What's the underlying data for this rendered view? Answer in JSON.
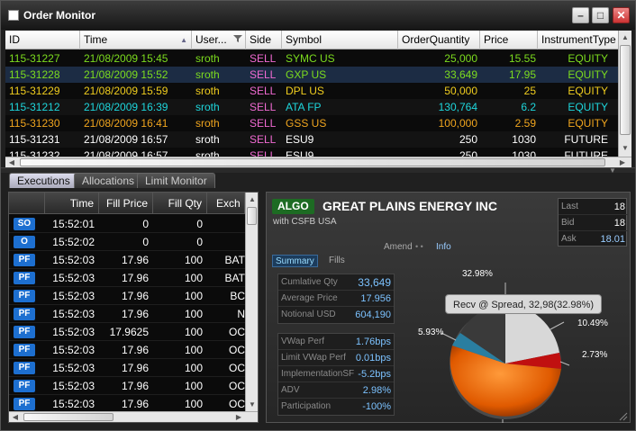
{
  "window": {
    "title": "Order Monitor"
  },
  "grid": {
    "columns": [
      "ID",
      "Time",
      "User...",
      "Side",
      "Symbol",
      "OrderQuantity",
      "Price",
      "InstrumentType"
    ],
    "rows": [
      {
        "id": "115-31227",
        "time": "21/08/2009 15:45",
        "user": "sroth",
        "side": "SELL",
        "symbol": "SYMC US",
        "qty": "25,000",
        "price": "15.55",
        "type": "EQUITY",
        "color": "#7cdc1e",
        "selected": false
      },
      {
        "id": "115-31228",
        "time": "21/08/2009 15:52",
        "user": "sroth",
        "side": "SELL",
        "symbol": "GXP US",
        "qty": "33,649",
        "price": "17.95",
        "type": "EQUITY",
        "color": "#7cdc1e",
        "selected": true
      },
      {
        "id": "115-31229",
        "time": "21/08/2009 15:59",
        "user": "sroth",
        "side": "SELL",
        "symbol": "DPL US",
        "qty": "50,000",
        "price": "25",
        "type": "EQUITY",
        "color": "#f0cd1e",
        "selected": false
      },
      {
        "id": "115-31212",
        "time": "21/08/2009 16:39",
        "user": "sroth",
        "side": "SELL",
        "symbol": "ATA FP",
        "qty": "130,764",
        "price": "6.2",
        "type": "EQUITY",
        "color": "#1ed6dc",
        "selected": false
      },
      {
        "id": "115-31230",
        "time": "21/08/2009 16:41",
        "user": "sroth",
        "side": "SELL",
        "symbol": "GSS US",
        "qty": "100,000",
        "price": "2.59",
        "type": "EQUITY",
        "color": "#f0a51e",
        "selected": false
      },
      {
        "id": "115-31231",
        "time": "21/08/2009 16:57",
        "user": "sroth",
        "side": "SELL",
        "symbol": "ESU9",
        "qty": "250",
        "price": "1030",
        "type": "FUTURE",
        "color": "#ffffff",
        "selected": false
      },
      {
        "id": "115-31232",
        "time": "21/08/2009 16:57",
        "user": "sroth",
        "side": "SELL",
        "symbol": "ESU9",
        "qty": "250",
        "price": "1030",
        "type": "FUTURE",
        "color": "#ffffff",
        "selected": false
      }
    ],
    "side_color": "#f06ad2"
  },
  "tabs": [
    "Executions",
    "Allocations",
    "Limit Monitor"
  ],
  "executions": {
    "columns": [
      "Time",
      "Fill Price",
      "Fill Qty",
      "Exch"
    ],
    "rows": [
      {
        "badge": "SO",
        "time": "15:52:01",
        "price": "0",
        "qty": "0",
        "exch": ""
      },
      {
        "badge": "O",
        "time": "15:52:02",
        "price": "0",
        "qty": "0",
        "exch": ""
      },
      {
        "badge": "PF",
        "time": "15:52:03",
        "price": "17.96",
        "qty": "100",
        "exch": "BAT"
      },
      {
        "badge": "PF",
        "time": "15:52:03",
        "price": "17.96",
        "qty": "100",
        "exch": "BAT"
      },
      {
        "badge": "PF",
        "time": "15:52:03",
        "price": "17.96",
        "qty": "100",
        "exch": "BC"
      },
      {
        "badge": "PF",
        "time": "15:52:03",
        "price": "17.96",
        "qty": "100",
        "exch": "N"
      },
      {
        "badge": "PF",
        "time": "15:52:03",
        "price": "17.9625",
        "qty": "100",
        "exch": "OC"
      },
      {
        "badge": "PF",
        "time": "15:52:03",
        "price": "17.96",
        "qty": "100",
        "exch": "OC"
      },
      {
        "badge": "PF",
        "time": "15:52:03",
        "price": "17.96",
        "qty": "100",
        "exch": "OC"
      },
      {
        "badge": "PF",
        "time": "15:52:03",
        "price": "17.96",
        "qty": "100",
        "exch": "OC"
      },
      {
        "badge": "PF",
        "time": "15:52:03",
        "price": "17.96",
        "qty": "100",
        "exch": "OC"
      }
    ]
  },
  "algo": {
    "tag": "ALGO",
    "company": "GREAT PLAINS ENERGY INC",
    "broker": "with CSFB USA",
    "quote": [
      {
        "label": "Last",
        "value": "18"
      },
      {
        "label": "Bid",
        "value": "18"
      },
      {
        "label": "Ask",
        "value": "18.01"
      }
    ],
    "amend": "Amend",
    "info": "Info",
    "subtabs": [
      "Summary",
      "Fills"
    ],
    "stats1": [
      {
        "label": "Cumlative Qty",
        "value": "33,649"
      },
      {
        "label": "Average Price",
        "value": "17.956"
      },
      {
        "label": "Notional USD",
        "value": "604,190"
      }
    ],
    "stats2": [
      {
        "label": "VWap Perf",
        "value": "1.76bps"
      },
      {
        "label": "Limit VWap Perf",
        "value": "0.01bps"
      },
      {
        "label": "ImplementationSF",
        "value": "-5.2bps"
      },
      {
        "label": "ADV",
        "value": "2.98%"
      },
      {
        "label": "Participation",
        "value": "-100%"
      }
    ],
    "tooltip": "Recv @ Spread, 32,98(32.98%)",
    "pie_labels": [
      "32.98%",
      "10.49%",
      "5.93%",
      "2.73%"
    ]
  }
}
